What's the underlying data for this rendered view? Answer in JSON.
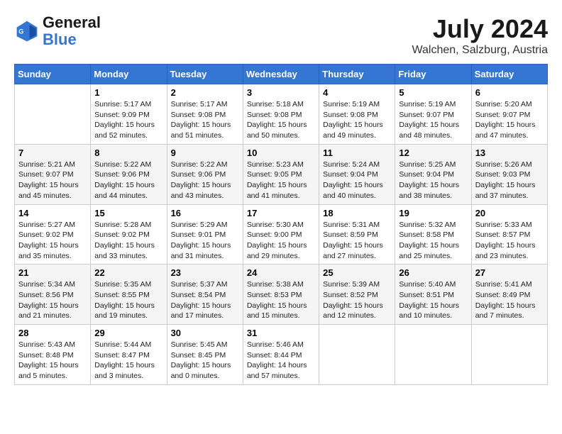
{
  "header": {
    "logo_general": "General",
    "logo_blue": "Blue",
    "month_year": "July 2024",
    "location": "Walchen, Salzburg, Austria"
  },
  "days_of_week": [
    "Sunday",
    "Monday",
    "Tuesday",
    "Wednesday",
    "Thursday",
    "Friday",
    "Saturday"
  ],
  "weeks": [
    [
      {
        "day": "",
        "content": ""
      },
      {
        "day": "1",
        "content": "Sunrise: 5:17 AM\nSunset: 9:09 PM\nDaylight: 15 hours\nand 52 minutes."
      },
      {
        "day": "2",
        "content": "Sunrise: 5:17 AM\nSunset: 9:08 PM\nDaylight: 15 hours\nand 51 minutes."
      },
      {
        "day": "3",
        "content": "Sunrise: 5:18 AM\nSunset: 9:08 PM\nDaylight: 15 hours\nand 50 minutes."
      },
      {
        "day": "4",
        "content": "Sunrise: 5:19 AM\nSunset: 9:08 PM\nDaylight: 15 hours\nand 49 minutes."
      },
      {
        "day": "5",
        "content": "Sunrise: 5:19 AM\nSunset: 9:07 PM\nDaylight: 15 hours\nand 48 minutes."
      },
      {
        "day": "6",
        "content": "Sunrise: 5:20 AM\nSunset: 9:07 PM\nDaylight: 15 hours\nand 47 minutes."
      }
    ],
    [
      {
        "day": "7",
        "content": "Sunrise: 5:21 AM\nSunset: 9:07 PM\nDaylight: 15 hours\nand 45 minutes."
      },
      {
        "day": "8",
        "content": "Sunrise: 5:22 AM\nSunset: 9:06 PM\nDaylight: 15 hours\nand 44 minutes."
      },
      {
        "day": "9",
        "content": "Sunrise: 5:22 AM\nSunset: 9:06 PM\nDaylight: 15 hours\nand 43 minutes."
      },
      {
        "day": "10",
        "content": "Sunrise: 5:23 AM\nSunset: 9:05 PM\nDaylight: 15 hours\nand 41 minutes."
      },
      {
        "day": "11",
        "content": "Sunrise: 5:24 AM\nSunset: 9:04 PM\nDaylight: 15 hours\nand 40 minutes."
      },
      {
        "day": "12",
        "content": "Sunrise: 5:25 AM\nSunset: 9:04 PM\nDaylight: 15 hours\nand 38 minutes."
      },
      {
        "day": "13",
        "content": "Sunrise: 5:26 AM\nSunset: 9:03 PM\nDaylight: 15 hours\nand 37 minutes."
      }
    ],
    [
      {
        "day": "14",
        "content": "Sunrise: 5:27 AM\nSunset: 9:02 PM\nDaylight: 15 hours\nand 35 minutes."
      },
      {
        "day": "15",
        "content": "Sunrise: 5:28 AM\nSunset: 9:02 PM\nDaylight: 15 hours\nand 33 minutes."
      },
      {
        "day": "16",
        "content": "Sunrise: 5:29 AM\nSunset: 9:01 PM\nDaylight: 15 hours\nand 31 minutes."
      },
      {
        "day": "17",
        "content": "Sunrise: 5:30 AM\nSunset: 9:00 PM\nDaylight: 15 hours\nand 29 minutes."
      },
      {
        "day": "18",
        "content": "Sunrise: 5:31 AM\nSunset: 8:59 PM\nDaylight: 15 hours\nand 27 minutes."
      },
      {
        "day": "19",
        "content": "Sunrise: 5:32 AM\nSunset: 8:58 PM\nDaylight: 15 hours\nand 25 minutes."
      },
      {
        "day": "20",
        "content": "Sunrise: 5:33 AM\nSunset: 8:57 PM\nDaylight: 15 hours\nand 23 minutes."
      }
    ],
    [
      {
        "day": "21",
        "content": "Sunrise: 5:34 AM\nSunset: 8:56 PM\nDaylight: 15 hours\nand 21 minutes."
      },
      {
        "day": "22",
        "content": "Sunrise: 5:35 AM\nSunset: 8:55 PM\nDaylight: 15 hours\nand 19 minutes."
      },
      {
        "day": "23",
        "content": "Sunrise: 5:37 AM\nSunset: 8:54 PM\nDaylight: 15 hours\nand 17 minutes."
      },
      {
        "day": "24",
        "content": "Sunrise: 5:38 AM\nSunset: 8:53 PM\nDaylight: 15 hours\nand 15 minutes."
      },
      {
        "day": "25",
        "content": "Sunrise: 5:39 AM\nSunset: 8:52 PM\nDaylight: 15 hours\nand 12 minutes."
      },
      {
        "day": "26",
        "content": "Sunrise: 5:40 AM\nSunset: 8:51 PM\nDaylight: 15 hours\nand 10 minutes."
      },
      {
        "day": "27",
        "content": "Sunrise: 5:41 AM\nSunset: 8:49 PM\nDaylight: 15 hours\nand 7 minutes."
      }
    ],
    [
      {
        "day": "28",
        "content": "Sunrise: 5:43 AM\nSunset: 8:48 PM\nDaylight: 15 hours\nand 5 minutes."
      },
      {
        "day": "29",
        "content": "Sunrise: 5:44 AM\nSunset: 8:47 PM\nDaylight: 15 hours\nand 3 minutes."
      },
      {
        "day": "30",
        "content": "Sunrise: 5:45 AM\nSunset: 8:45 PM\nDaylight: 15 hours\nand 0 minutes."
      },
      {
        "day": "31",
        "content": "Sunrise: 5:46 AM\nSunset: 8:44 PM\nDaylight: 14 hours\nand 57 minutes."
      },
      {
        "day": "",
        "content": ""
      },
      {
        "day": "",
        "content": ""
      },
      {
        "day": "",
        "content": ""
      }
    ]
  ]
}
